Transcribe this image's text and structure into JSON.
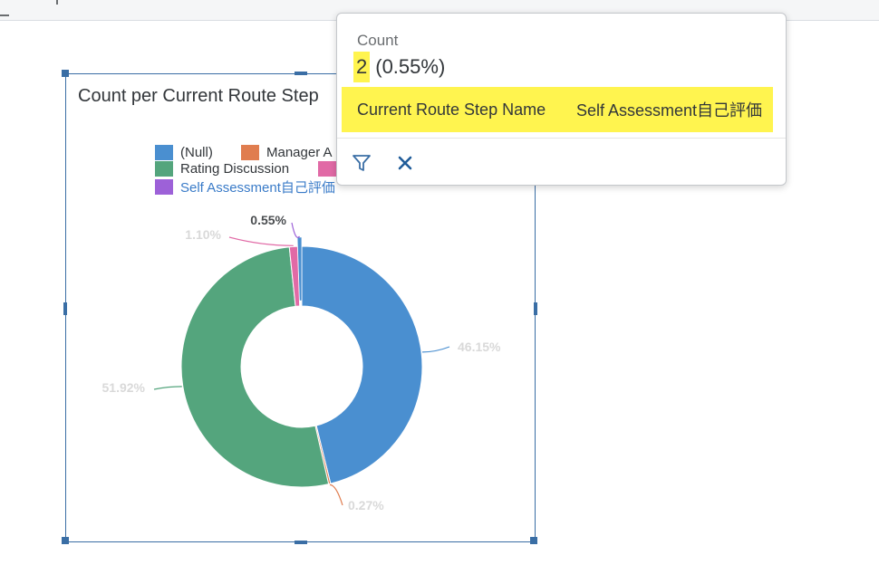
{
  "chart_data": {
    "type": "pie",
    "title": "Count per Current Route Step",
    "legend": [
      {
        "label": "(Null)",
        "color": "#4a8fd0"
      },
      {
        "label": "Manager A",
        "color": "#e07d4f"
      },
      {
        "label": "Rating Discussion",
        "color": "#54a57d"
      },
      {
        "label": "",
        "color": "#e16aa6"
      },
      {
        "label": "Self Assessment自己評価",
        "color": "#9d61d8",
        "selected": true
      }
    ],
    "slices": [
      {
        "color": "#4a8fd0",
        "percent": 46.15,
        "label": "46.15%"
      },
      {
        "color": "#e07d4f",
        "percent": 0.27,
        "label": "0.27%"
      },
      {
        "color": "#54a57d",
        "percent": 51.92,
        "label": "51.92%"
      },
      {
        "color": "#e16aa6",
        "percent": 1.1,
        "label": "1.10%"
      },
      {
        "color": "#4a8fd0",
        "percent": 0.55,
        "label": "0.55%",
        "selected": true
      }
    ]
  },
  "tooltip": {
    "measure": "Count",
    "value": "2",
    "percent": "(0.55%)",
    "dimension": "Current Route Step Name",
    "member": "Self Assessment自己評価",
    "filter_icon": "filter-icon",
    "close_icon": "close-icon"
  }
}
